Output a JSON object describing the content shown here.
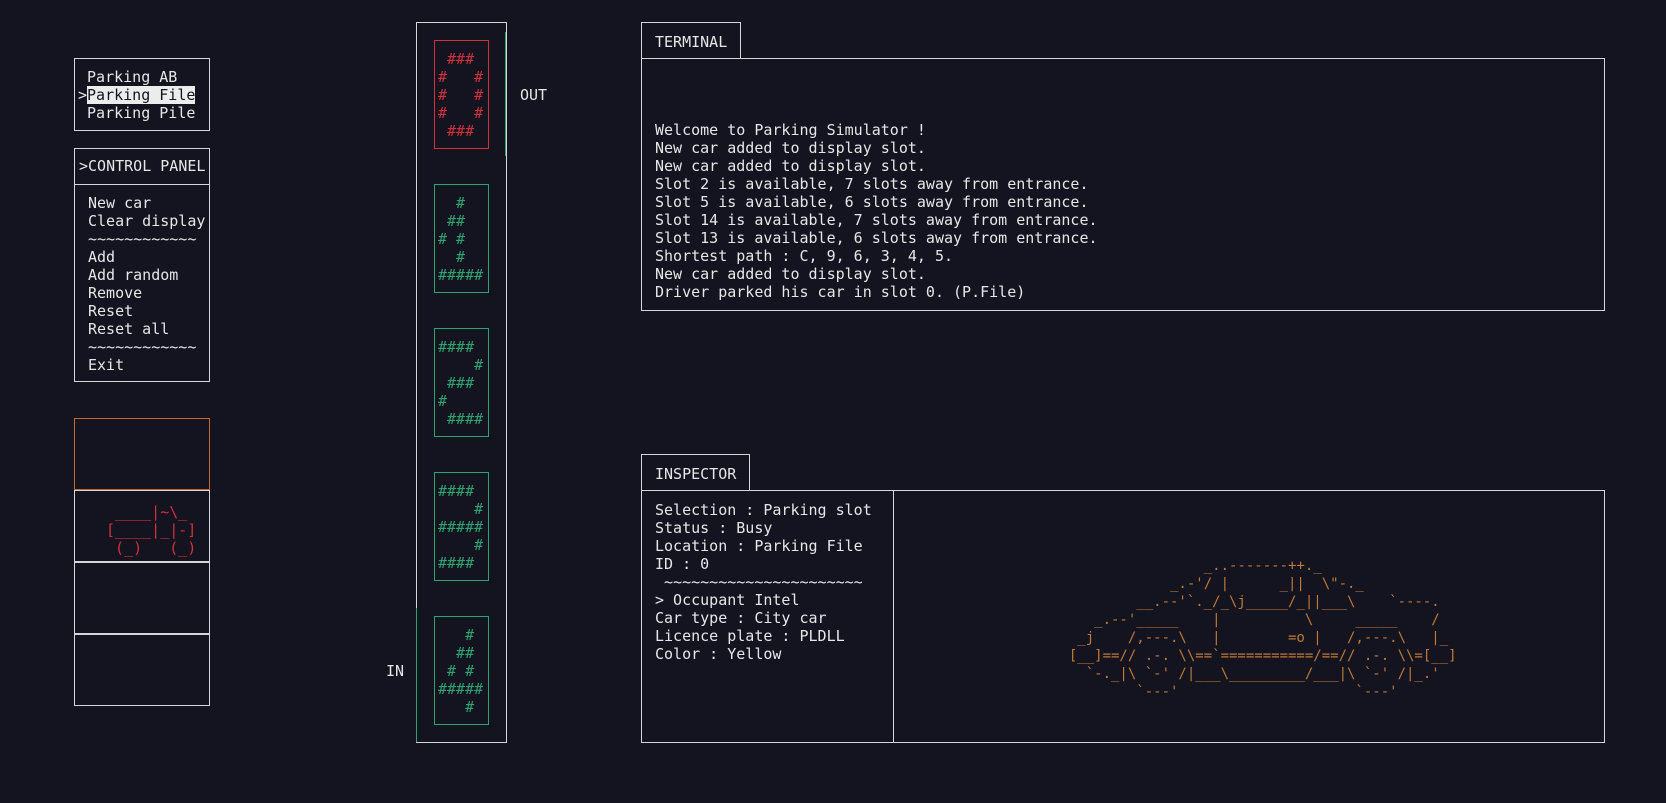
{
  "parking_menu": {
    "items": [
      {
        "label": "Parking AB",
        "selected": false
      },
      {
        "label": "Parking File",
        "selected": true
      },
      {
        "label": "Parking Pile",
        "selected": false
      }
    ],
    "selected_marker": ">"
  },
  "control_panel": {
    "title": ">CONTROL PANEL",
    "items": [
      "New car",
      "Clear display",
      "~~~~~~~~~~~~",
      "Add",
      "Add random",
      "Remove",
      "Reset",
      "Reset all",
      "~~~~~~~~~~~~",
      "Exit"
    ]
  },
  "display": {
    "car_ascii": "  ____|~\\_\n [____|_|-]\n  (_)   (_)"
  },
  "parking_column": {
    "out_label": "OUT",
    "in_label": "IN",
    "slots": [
      {
        "digits": " ###\n#   #\n#   #\n#   #\n ###",
        "status": "busy"
      },
      {
        "digits": "  #\n ##\n# #\n  #\n#####",
        "status": "free"
      },
      {
        "digits": "####\n    #\n ###\n#\n ####",
        "status": "free"
      },
      {
        "digits": "####\n    #\n#####\n    #\n####",
        "status": "free"
      },
      {
        "digits": "   #\n  ##\n # #\n#####\n   #",
        "status": "free"
      }
    ],
    "colors": {
      "free": "#2fa36f",
      "busy": "#d1303c"
    }
  },
  "terminal": {
    "tab_label": "TERMINAL",
    "lines": [
      "Welcome to Parking Simulator !",
      "New car added to display slot.",
      "New car added to display slot.",
      "Slot 2 is available, 7 slots away from entrance.",
      "Slot 5 is available, 6 slots away from entrance.",
      "Slot 14 is available, 7 slots away from entrance.",
      "Slot 13 is available, 6 slots away from entrance.",
      "Shortest path : C, 9, 6, 3, 4, 5.",
      "New car added to display slot.",
      "Driver parked his car in slot 0. (P.File)"
    ]
  },
  "inspector": {
    "tab_label": "INSPECTOR",
    "lines": [
      "Selection : Parking slot",
      "Status : Busy",
      "Location : Parking File",
      "ID : 0",
      " ~~~~~~~~~~~~~~~~~~~~~~",
      "> Occupant Intel",
      "Car type : City car",
      "Licence plate : PLDLL",
      "Color : Yellow"
    ],
    "car_ascii": "                  _..-------++._\n              _.-'/ |      _||  \\\"-._\n          __.--'`._/_\\j_____/_||___\\    `----.\n     _.--'_____    |          \\     _____    /\n   _j    /,---.\\   |        =o |   /,---.\\   |_\n  [__]==// .-. \\\\==`===========/==// .-. \\\\=[__]\n    `-._|\\ `-' /|___\\_________/___|\\ `-' /|_.'\n          `---'                     `---'",
    "car_color": "#c07832"
  }
}
